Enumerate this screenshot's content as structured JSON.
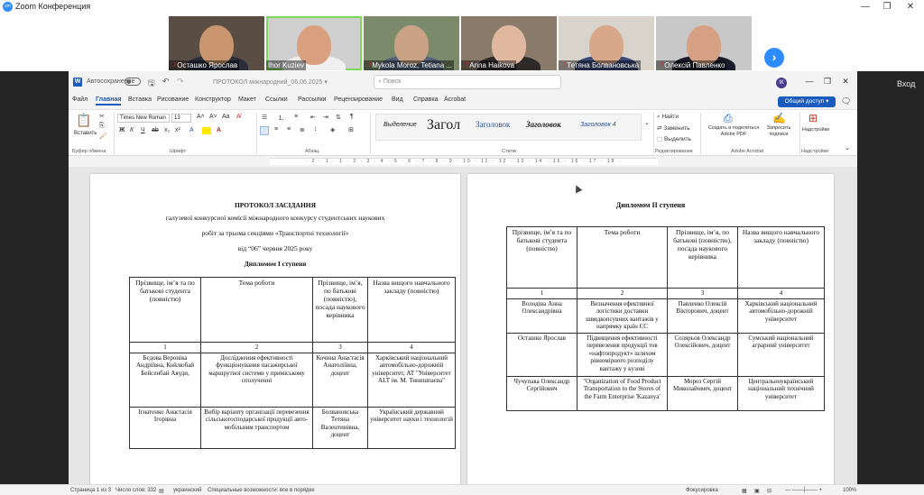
{
  "zoom": {
    "title": "Zoom Конференция",
    "logo": "zm",
    "window_controls": [
      "—",
      "❐",
      "✕"
    ],
    "participants": [
      {
        "name": "Осташко Ярослав",
        "muted": true,
        "skin": "#c9956e",
        "shirt": "#2a2d3a",
        "bg": "#5a4e44"
      },
      {
        "name": "Ihor Kuziev",
        "muted": false,
        "skin": "#d8a07f",
        "shirt": "#f0f0f0",
        "bg": "#cfcfcf",
        "active": true
      },
      {
        "name": "Mykola Moroz, Tetiana ...",
        "muted": true,
        "skin": "#caa285",
        "shirt": "#55627a",
        "bg": "#7a8a6a"
      },
      {
        "name": "Anna Haikova",
        "muted": true,
        "skin": "#e0b8a0",
        "shirt": "#2e2a2a",
        "bg": "#8a7a6a"
      },
      {
        "name": "Тетяна Болвановська",
        "muted": true,
        "skin": "#d9a88a",
        "shirt": "#3a4a7a",
        "bg": "#d8d4cc"
      },
      {
        "name": "Олексій Павленко",
        "muted": true,
        "skin": "#d5a083",
        "shirt": "#1a1a2a",
        "bg": "#c8c8c8"
      }
    ],
    "next_icon": "›",
    "join_label": "Вход"
  },
  "word": {
    "autosave_label": "Автосохранение",
    "doc_title": "ПРОТОКОЛ міжнародний_06.06.2025 ▾",
    "search_placeholder": "Поиск",
    "avatar": "ІК",
    "tabs": [
      "Файл",
      "Главная",
      "Вставка",
      "Рисование",
      "Конструктор",
      "Макет",
      "Ссылки",
      "Рассылки",
      "Рецензирование",
      "Вид",
      "Справка",
      "Acrobat"
    ],
    "active_tab": "Главная",
    "share_label": "Общий доступ ▾",
    "ribbon": {
      "paste": "Вставить",
      "clipboard_label": "Буфер обмена",
      "font_name": "Times New Roman",
      "font_size": "13",
      "font_label": "Шрифт",
      "paragraph_label": "Абзац",
      "styles_label": "Стили",
      "styles": [
        "Выделение",
        "Загол",
        "Заголовок",
        "Заголовок",
        "Заголовок 4"
      ],
      "find": "Найти",
      "replace": "Заменить",
      "select": "Выделить",
      "editing_label": "Редактирование",
      "create_pdf": "Создать и поделиться Adobe PDF",
      "request_sign": "Запросить подписи",
      "acrobat_label": "Adobe Acrobat",
      "addins": "Надстройки",
      "addins_label": "Надстройки"
    },
    "ruler": "· 2 · 1 · 1 · 2 · 3 · 4 · 5 · 6 · 7 · 8 · 9 · 10 · 11 · 12 · 13 · 14 · 15 · 16 · 17 · 18 ·"
  },
  "page1": {
    "h1": "ПРОТОКОЛ ЗАСІДАННЯ",
    "l2": "галузевої конкурсної комісії міжнародного конкурсу студентських наукових",
    "l3": "робіт за трьома секціями «Транспортні технології»",
    "l4": "від “06” червня 2025 року",
    "h2": "Дипломом І ступеня",
    "headers": [
      "Прізвище, ім’я та по батькові студента (повністю)",
      "Тема роботи",
      "Прізвище, ім’я, по батькові (повністю), посада наукового керівника",
      "Назва вищого навчального закладу (повністю)"
    ],
    "nums": [
      "1",
      "2",
      "3",
      "4"
    ],
    "rows": [
      [
        "Бєдова Вероніка Андріївна, Койлюбай Бейсенбай Аяуди,",
        "Дослідження ефективності функціонування пасажирської маршрутної системи у приміському сполученні",
        "Кочина Анастасія Анатоліївна, доцент",
        "Харківський національний автомобільно-дорожній університет, АТ \"Університет ALT ім. М. Тинишпаєва\""
      ],
      [
        "Ігнатенко Анастасія Ігорівна",
        "Вибір варіанту організації перевезення сільськогосподарської продукції авто-мобільним транспортом",
        "Болвановська Тетяна Валентинівна, доцент",
        "Український державний університет науки і технологій"
      ]
    ]
  },
  "page2": {
    "h2": "Дипломом ІІ ступеня",
    "headers": [
      "Прізвище, ім’я та по батькові студента (повністю)",
      "Тема роботи",
      "Прізвище, ім’я, по батькові (повністю), посада наукового керівника",
      "Назва вищого навчального закладу (повністю)"
    ],
    "nums": [
      "1",
      "2",
      "3",
      "4"
    ],
    "rows": [
      [
        "Володіна Анна Олександрівна",
        "Визначення ефективної логістики доставки швидкопсувних вантажів у напрямку країн ЄС",
        "Павленко Олексій Вікторович, доцент",
        "Харківський національний автомобільно-дорожній університет"
      ],
      [
        "Осташко Ярослав",
        "Підвищення ефективності перевезення продукції тов «нафтопродукт» шляхом рівномірного розподілу вантажу у кузові",
        "Солярьов Олександр Олексійович, доцент",
        "Сумський національний аграрний університет"
      ],
      [
        "Чучупака Олександр Сергійович",
        "\"Organization of Food Product Transportation to the Stores of the Farm Enterprise 'Kazanya'",
        "Мороз Сергій Миколайович, доцент",
        "Центральноукраїнський національний технічний університет"
      ]
    ]
  },
  "status": {
    "page": "Страница 1 из 3",
    "words": "Число слов: 332",
    "lang": "украинский",
    "access": "Специальные возможности: все в порядке",
    "focus": "Фокусировка",
    "zoom": "100%"
  }
}
